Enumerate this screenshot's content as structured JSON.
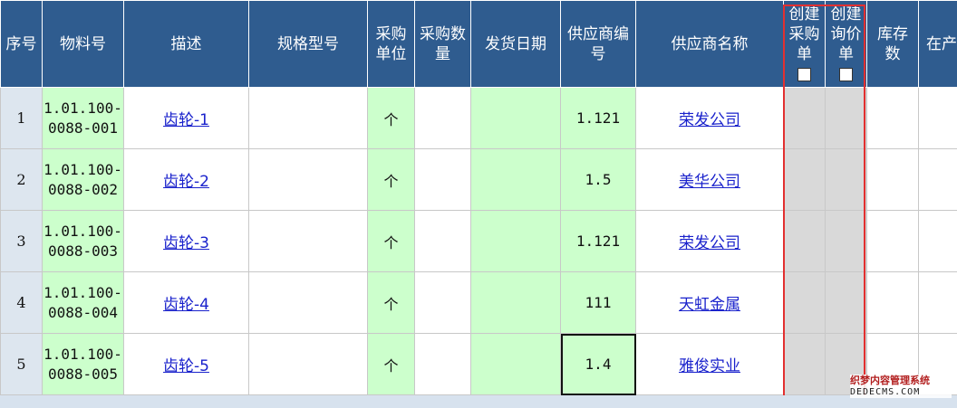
{
  "headers": {
    "seq": "序号",
    "material_no": "物料号",
    "description": "描述",
    "spec": "规格型号",
    "unit": "采购单位",
    "qty": "采购数量",
    "ship_date": "发货日期",
    "supplier_code": "供应商编号",
    "supplier_name": "供应商名称",
    "create_po": "创建采购单",
    "create_rfq": "创建询价单",
    "stock": "库存数",
    "in_production": "在产"
  },
  "rows": [
    {
      "seq": "1",
      "material_no": "1.01.100-0088-001",
      "description": "齿轮-1",
      "spec": "",
      "unit": "个",
      "qty": "",
      "ship_date": "",
      "supplier_code": "1.121",
      "supplier_name": "荣发公司"
    },
    {
      "seq": "2",
      "material_no": "1.01.100-0088-002",
      "description": "齿轮-2",
      "spec": "",
      "unit": "个",
      "qty": "",
      "ship_date": "",
      "supplier_code": "1.5",
      "supplier_name": "美华公司"
    },
    {
      "seq": "3",
      "material_no": "1.01.100-0088-003",
      "description": "齿轮-3",
      "spec": "",
      "unit": "个",
      "qty": "",
      "ship_date": "",
      "supplier_code": "1.121",
      "supplier_name": "荣发公司"
    },
    {
      "seq": "4",
      "material_no": "1.01.100-0088-004",
      "description": "齿轮-4",
      "spec": "",
      "unit": "个",
      "qty": "",
      "ship_date": "",
      "supplier_code": "111",
      "supplier_name": "天虹金属"
    },
    {
      "seq": "5",
      "material_no": "1.01.100-0088-005",
      "description": "齿轮-5",
      "spec": "",
      "unit": "个",
      "qty": "",
      "ship_date": "",
      "supplier_code": "1.4",
      "supplier_name": "雅俊实业"
    }
  ],
  "selected_row": 5,
  "watermark": {
    "line1": "织梦内容管理系统",
    "line2": "DEDECMS.COM"
  },
  "colors": {
    "header_bg": "#2f5c8f",
    "green_cell": "#ccffcc",
    "gray_cell": "#d9d9d9",
    "highlight_box": "#e23030",
    "link": "#1a22cc"
  }
}
